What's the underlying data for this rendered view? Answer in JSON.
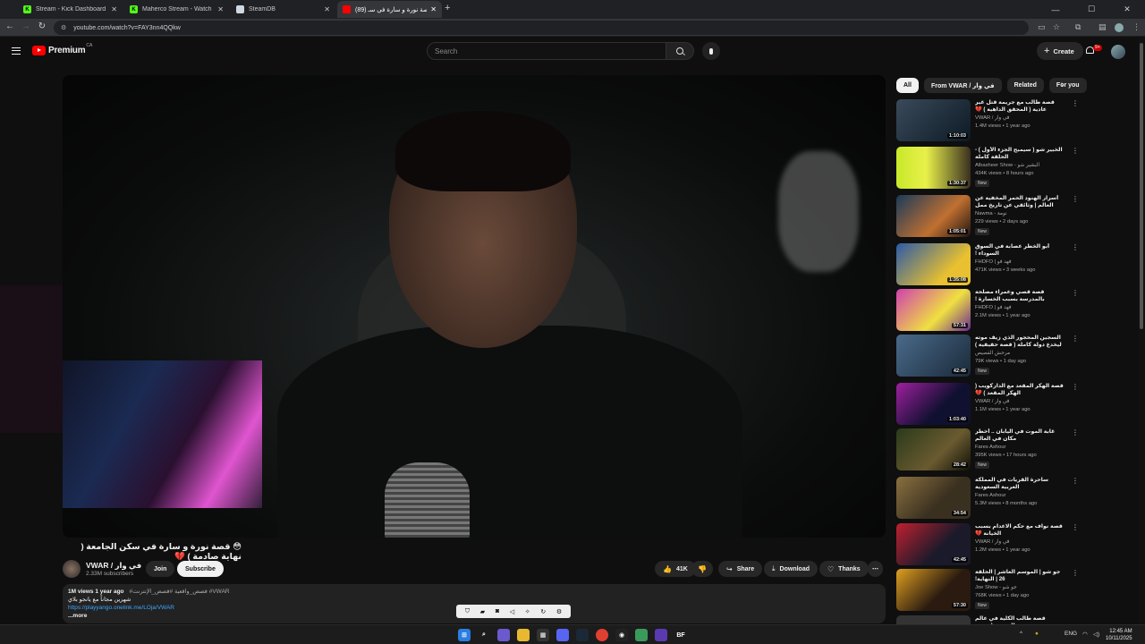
{
  "browser": {
    "tabs": [
      {
        "title": "Stream - Kick Dashboard",
        "favicon": "kick-icon",
        "color": "#53fc18"
      },
      {
        "title": "Maherco Stream - Watch L",
        "favicon": "kick-icon",
        "color": "#53fc18"
      },
      {
        "title": "SteamDB",
        "favicon": "steamdb-icon",
        "color": "#cfd8e3"
      },
      {
        "title": "(89) قصة نورة و سارة في سـ",
        "favicon": "youtube-icon",
        "color": "#ff0000"
      }
    ],
    "url": "youtube.com/watch?v=FAY3nn4QQkw"
  },
  "header": {
    "logo_text": "Premium",
    "country": "CA",
    "search_placeholder": "Search",
    "create_label": "Create",
    "notif_count": "9+"
  },
  "video": {
    "title": "😳 قصة نورة و سارة في سكن الجامعة ( نهاية صادمة ) 💔",
    "channel": "VWAR / في وار",
    "subscribers": "2.33M subscribers",
    "join": "Join",
    "subscribe": "Subscribe",
    "likes": "41K",
    "share": "Share",
    "download": "Download",
    "thanks": "Thanks"
  },
  "description": {
    "views": "1M views",
    "age": "1 year ago",
    "tags": "#قصص_واقعية #قصص_الإنترنت #VWAR",
    "line1": "شهرين مجاناً مع يانجو بلاي",
    "link": "https://playyango.onelink.me/LOja/VWAR",
    "more": "...more"
  },
  "chips": [
    "All",
    "From VWAR / في وار",
    "Related",
    "For you"
  ],
  "related": [
    {
      "title": "قصة طالب مع جريمة قتل غير عادية ( المحقق الداهية ) 💔",
      "channel": "VWAR / في وار",
      "meta": "1.4M views • 1 year ago",
      "duration": "1:10:03",
      "new": ""
    },
    {
      "title": "الخبير شو ( سيمبح الجزء الأول ) - الحلقة كاملة",
      "channel": "Albasheer Show - البشير شو",
      "meta": "434K views • 8 hours ago",
      "duration": "1:30:37",
      "new": "New"
    },
    {
      "title": "أسرار الهنود الحمر المخفية عن العالم | وثائقي عن تاريخ ممل للنوم",
      "channel": "Nawma - نومة",
      "meta": "229 views • 2 days ago",
      "duration": "1:05:01",
      "new": "New"
    },
    {
      "title": "أبو الخطر عصابة في السوق السوداء !",
      "channel": "FHDFO | فهد فو",
      "meta": "471K views • 3 weeks ago",
      "duration": "1:35:08",
      "new": ""
    },
    {
      "title": "قصة قصي وعمراء مصلحة بالمدرسة بسبب الخسارة !",
      "channel": "FHDFO | فهد فو",
      "meta": "2.1M views • 1 year ago",
      "duration": "57:31",
      "new": ""
    },
    {
      "title": "السجين المحجور الذي زيف موته ليخدع دولة كاملة ( قصة حقيقية )",
      "channel": "مرحش القصيص",
      "meta": "79K views • 1 day ago",
      "duration": "42:45",
      "new": "New"
    },
    {
      "title": "قصة الهكر المقعد مع الداركويب ( الهكر المقعد ) 💔",
      "channel": "VWAR / في وار",
      "meta": "1.1M views • 1 year ago",
      "duration": "1:03:40",
      "new": ""
    },
    {
      "title": "غابة الموت في اليابان .. أخطر مكان في العالم",
      "channel": "Fares Ashour",
      "meta": "395K views • 17 hours ago",
      "duration": "28:42",
      "new": "New"
    },
    {
      "title": "ساحرة القريات في المملكة العربية السعودية",
      "channel": "Fares Ashour",
      "meta": "5.3M views • 8 months ago",
      "duration": "34:54",
      "new": ""
    },
    {
      "title": "قصة نواف مع حكم الاعدام بسبب الخيانة 💔",
      "channel": "VWAR / في وار",
      "meta": "1.2M views • 1 year ago",
      "duration": "42:45",
      "new": ""
    },
    {
      "title": "جو شو | الموسم العاشر | الحلقة 26 | النهاية!",
      "channel": "Joe Show - جو شو",
      "meta": "768K views • 1 day ago",
      "duration": "57:30",
      "new": "New"
    },
    {
      "title": "قصة طالب الكلية في عالم الجريمة ( سجن",
      "channel": "",
      "meta": "",
      "duration": "",
      "new": ""
    }
  ],
  "taskbar": {
    "lang": "ENG",
    "time": "12:45 AM",
    "date": "10/11/2025"
  }
}
